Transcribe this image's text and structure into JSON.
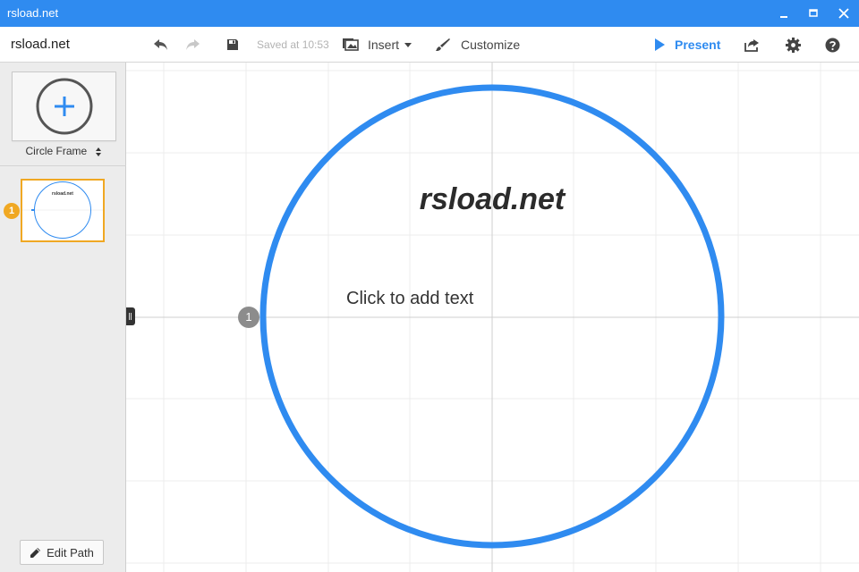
{
  "window": {
    "title": "rsload.net"
  },
  "toolbar": {
    "doc_title": "rsload.net",
    "saved_text": "Saved at 10:53",
    "insert_label": "Insert",
    "customize_label": "Customize",
    "present_label": "Present"
  },
  "sidebar": {
    "frame_type": "Circle Frame",
    "thumbnails": [
      {
        "number": "1",
        "title": "rsload.net"
      }
    ],
    "edit_path_label": "Edit Path"
  },
  "canvas": {
    "title": "rsload.net",
    "placeholder": "Click to add text",
    "path_number": "1"
  },
  "colors": {
    "accent": "#2f8bf0",
    "selection": "#f0a823",
    "frame_stroke": "#2f8bf0"
  }
}
